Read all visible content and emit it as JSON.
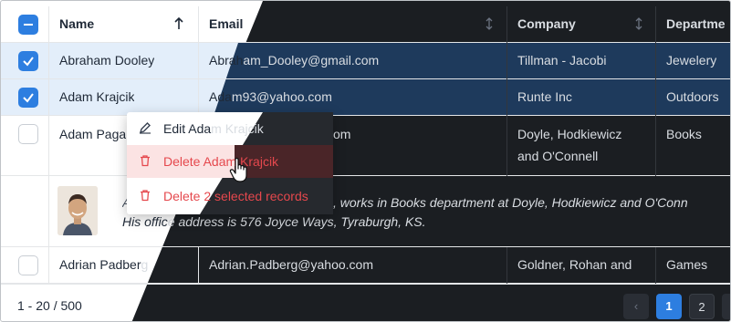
{
  "columns": {
    "name": "Name",
    "email": "Email",
    "company": "Company",
    "department": "Departme"
  },
  "rows": [
    {
      "name": "Abraham Dooley",
      "email": "Abraham_Dooley@gmail.com",
      "company": "Tillman - Jacobi",
      "department": "Jewelery",
      "checked": true
    },
    {
      "name": "Adam Krajcik",
      "email": "Adam93@yahoo.com",
      "company": "Runte Inc",
      "department": "Outdoors",
      "checked": true
    },
    {
      "name": "Adam Paga",
      "email": "om",
      "company_line1": "Doyle, Hodkiewicz",
      "company_line2": "and O'Connell",
      "department": "Books",
      "checked": false
    },
    {
      "name": "Adrian Padberg",
      "email": "Adrian.Padberg@yahoo.com",
      "company": "Goldner, Rohan and",
      "department": "Games",
      "checked": false
    }
  ],
  "detail": {
    "line1_prefix": "A",
    "line1": ", works in Books department at Doyle, Hodkiewicz and O'Conn",
    "line2": "His office address is 576 Joyce Ways, Tyraburgh, KS."
  },
  "context_menu": {
    "edit": "Edit Adam Krajcik",
    "delete": "Delete Adam Krajcik",
    "delete_selected": "Delete 2 selected records"
  },
  "footer": {
    "range": "1 - 20 / 500",
    "prev": "‹",
    "page1": "1",
    "page2": "2"
  },
  "colors": {
    "accent": "#2d7ee0",
    "danger": "#e5484d",
    "dark_bg": "#1b1e22"
  },
  "icons": {
    "sort_asc": "arrow-up-icon",
    "sort_both": "sort-icon",
    "edit": "edit-icon",
    "delete": "trash-icon",
    "cursor": "hand-cursor-icon"
  }
}
